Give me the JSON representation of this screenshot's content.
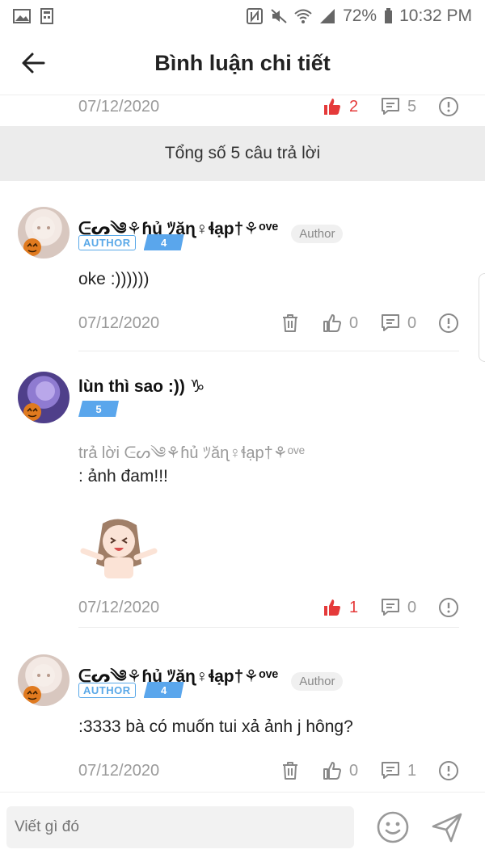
{
  "status_bar": {
    "battery": "72%",
    "time": "10:32 PM"
  },
  "header": {
    "title": "Bình luận chi tiết"
  },
  "top_item": {
    "date": "07/12/2020",
    "likes": "2",
    "comments": "5"
  },
  "summary": {
    "text": "Tổng số 5 câu trả lời"
  },
  "comments": [
    {
      "username": "ᕮᔕ༄⚘ɦủ ﾂăɳ♀ɬạp†⚘ᵒᵛᵉ",
      "author_tag": "Author",
      "badge_author": "AUTHOR",
      "level": "4",
      "text": "oke :))))))",
      "date": "07/12/2020",
      "likes": "0",
      "comments": "0"
    },
    {
      "username": "lùn thì sao :)) ♑",
      "level": "5",
      "reply_prefix": "trả lời",
      "reply_name": "ᕮᔕ༄⚘ɦủ ﾂăɳ♀ɬạp†⚘ᵒᵛᵉ",
      "text": ": ảnh đam!!!",
      "date": "07/12/2020",
      "likes": "1",
      "comments": "0"
    },
    {
      "username": "ᕮᔕ༄⚘ɦủ ﾂăɳ♀ɬạp†⚘ᵒᵛᵉ",
      "author_tag": "Author",
      "badge_author": "AUTHOR",
      "level": "4",
      "text": ":3333 bà có muốn tui xả ảnh j hông?",
      "date": "07/12/2020",
      "likes": "0",
      "comments": "1"
    }
  ],
  "input": {
    "placeholder": "Viết gì đó"
  },
  "icons": {
    "back": "arrow-left-icon",
    "like": "thumbs-up-icon",
    "comment": "comment-icon",
    "report": "exclamation-circle-icon",
    "delete": "trash-icon",
    "emoji": "smiley-icon",
    "send": "send-icon"
  },
  "colors": {
    "like_active": "#e53a3a",
    "badge_blue": "#59a8e8",
    "muted": "#9a9a9a"
  }
}
